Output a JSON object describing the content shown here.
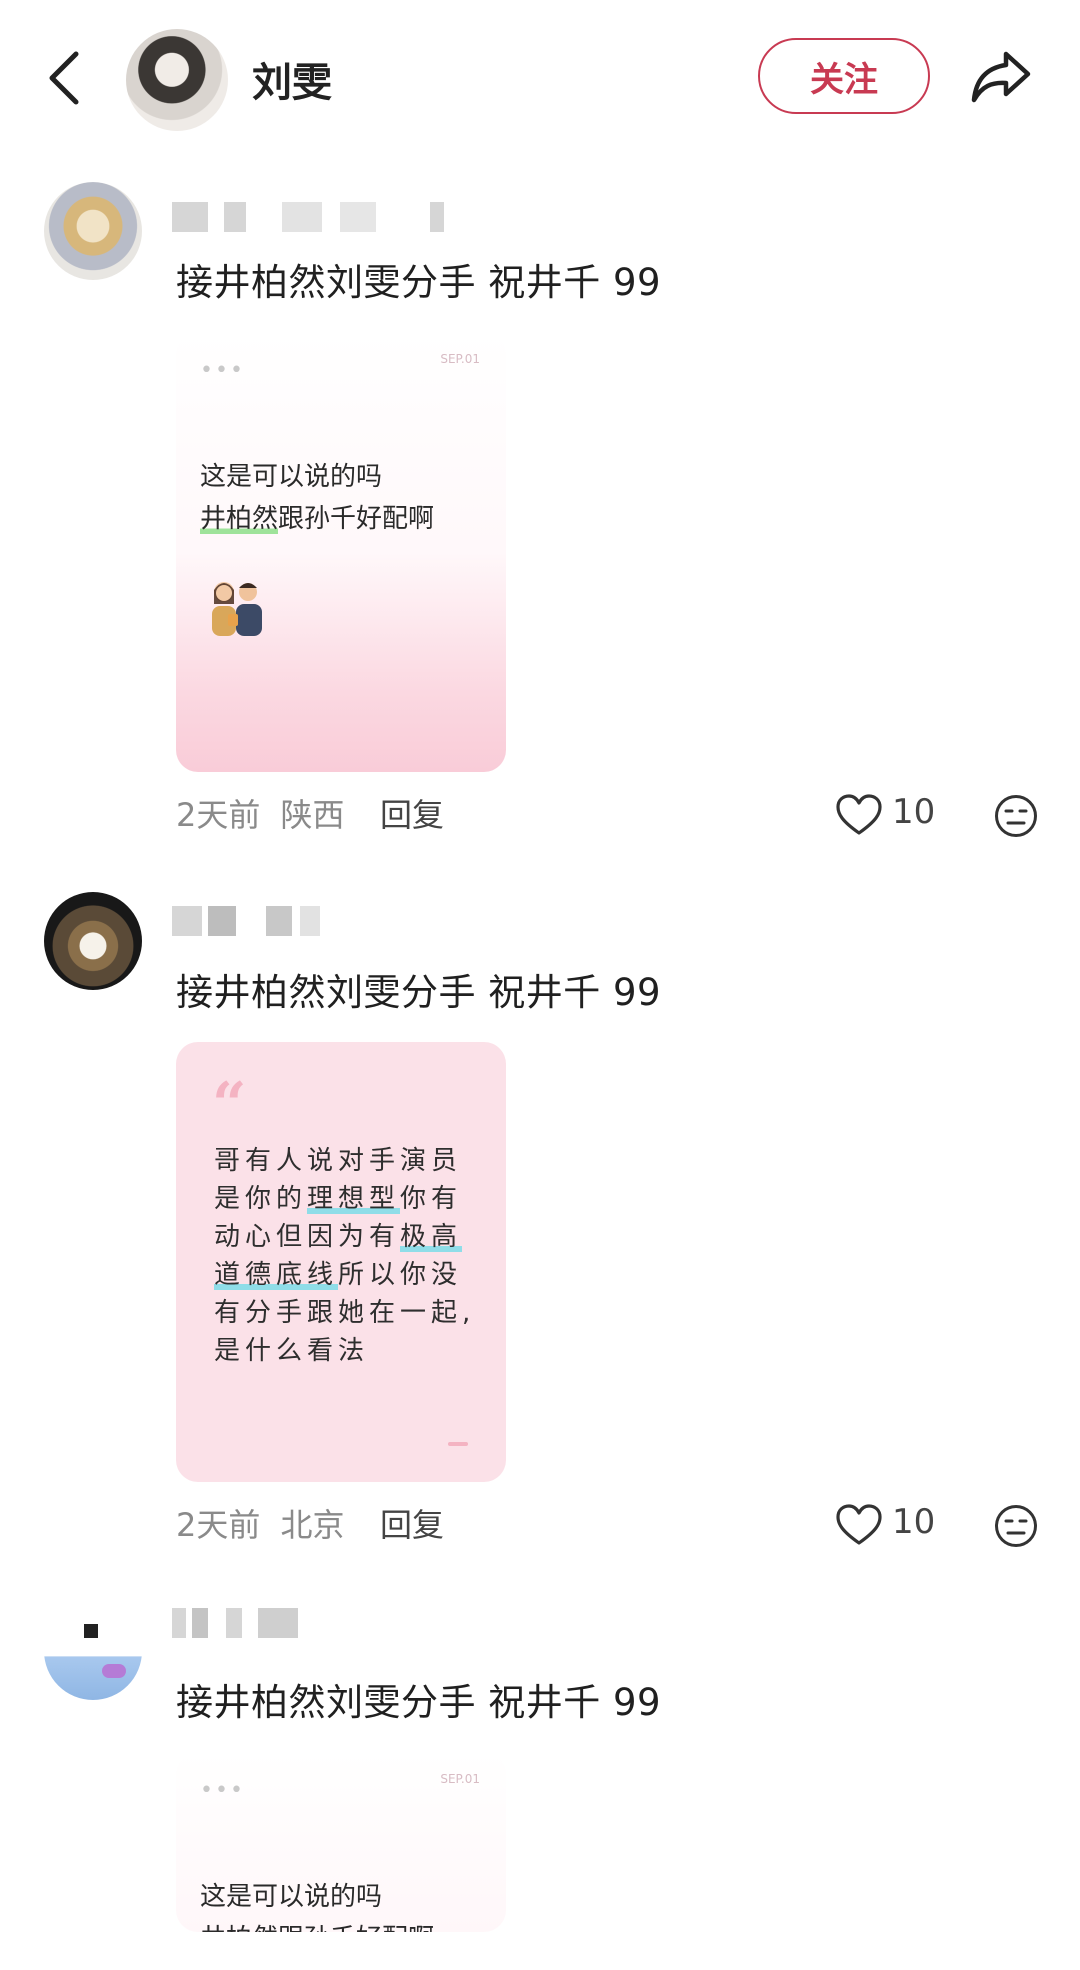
{
  "header": {
    "title": "刘雯",
    "follow_label": "关注",
    "back_icon": "back-arrow-icon",
    "share_icon": "share-icon"
  },
  "comments": [
    {
      "text": "接井柏然刘雯分手 祝井千 99",
      "card": {
        "dots": "•••",
        "stamp": "SEP.01",
        "line1": "这是可以说的吗",
        "line2_highlight": "井柏然",
        "line2_rest": "跟孙千好配啊"
      },
      "time": "2天前",
      "location": "陕西",
      "reply_label": "回复",
      "likes": "10"
    },
    {
      "text": "接井柏然刘雯分手 祝井千 99",
      "card": {
        "quote_mark": "“",
        "q1": "哥有人说对手演员",
        "q2a": "是你的",
        "q2b": "理想型",
        "q2c": "你有",
        "q3a": "动心但因为有",
        "q3b": "极高",
        "q4a": "道德底线",
        "q4b": "所以你没",
        "q5": "有分手跟她在一起,",
        "q6": "是什么看法"
      },
      "time": "2天前",
      "location": "北京",
      "reply_label": "回复",
      "likes": "10"
    },
    {
      "text": "接井柏然刘雯分手 祝井千 99",
      "card": {
        "dots": "•••",
        "stamp": "SEP.01",
        "line1": "这是可以说的吗",
        "line2": "井柏然跟孙千好配啊"
      }
    }
  ],
  "colors": {
    "accent": "#c83a52",
    "card_pink": "#fbe1e8"
  }
}
